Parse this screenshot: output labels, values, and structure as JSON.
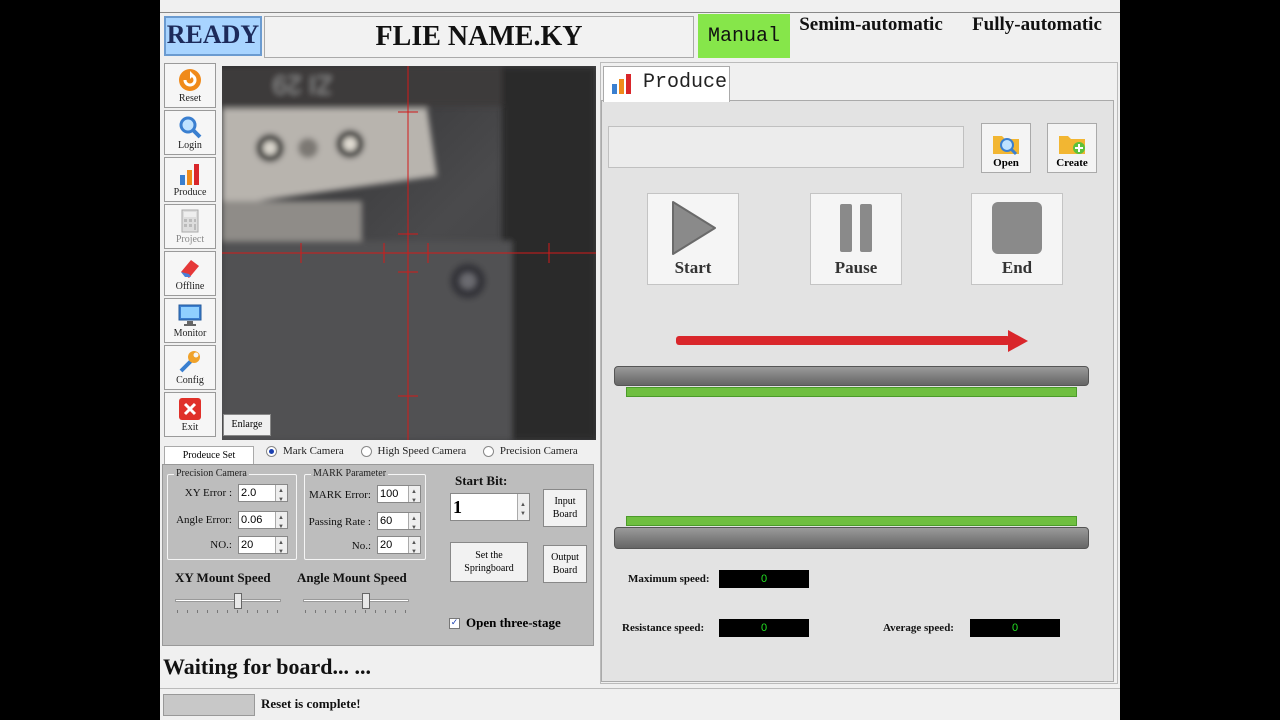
{
  "header": {
    "status": "READY",
    "filename": "FLIE NAME.KY",
    "modes": [
      "Manual",
      "Semim-automatic",
      "Fully-automatic"
    ],
    "active_mode": "Manual"
  },
  "toolbar": {
    "items": [
      {
        "label": "Reset",
        "icon": "reset-icon"
      },
      {
        "label": "Login",
        "icon": "magnifier-icon"
      },
      {
        "label": "Produce",
        "icon": "bar-chart-icon"
      },
      {
        "label": "Project",
        "icon": "calculator-icon"
      },
      {
        "label": "Offline",
        "icon": "eraser-icon"
      },
      {
        "label": "Monitor",
        "icon": "monitor-icon"
      },
      {
        "label": "Config",
        "icon": "wrench-icon"
      },
      {
        "label": "Exit",
        "icon": "close-icon"
      }
    ]
  },
  "camera": {
    "enlarge_label": "Enlarge",
    "options": [
      "Mark Camera",
      "High Speed Camera",
      "Precision Camera"
    ],
    "selected": "Mark Camera"
  },
  "produce_set": {
    "tab_label": "Prodeuce Set",
    "precision_camera": {
      "title": "Precision Camera",
      "xy_error_label": "XY Error :",
      "xy_error": "2.0",
      "angle_error_label": "Angle Error:",
      "angle_error": "0.06",
      "no_label": "NO.:",
      "no": "20"
    },
    "mark_parameter": {
      "title": "MARK Parameter",
      "mark_error_label": "MARK Error:",
      "mark_error": "100",
      "passing_rate_label": "Passing Rate :",
      "passing_rate": "60",
      "no_label": "No.:",
      "no": "20"
    },
    "start_bit_label": "Start Bit:",
    "start_bit": "1",
    "input_board_label": [
      "Input",
      "Board"
    ],
    "output_board_label": [
      "Output",
      "Board"
    ],
    "springboard_label": [
      "Set the",
      "Springboard"
    ],
    "xy_speed_label": "XY Mount Speed",
    "xy_speed": 0.6,
    "angle_speed_label": "Angle Mount Speed",
    "angle_speed": 0.6,
    "three_stage_label": "Open three-stage",
    "three_stage_checked": true
  },
  "status": {
    "waiting": "Waiting for board... ...",
    "reset_message": "Reset is complete!"
  },
  "produce": {
    "tab_label": "Produce",
    "open_label": "Open",
    "create_label": "Create",
    "start_label": "Start",
    "pause_label": "Pause",
    "end_label": "End",
    "max_speed_label": "Maximum speed:",
    "max_speed": "0",
    "resistance_speed_label": "Resistance speed:",
    "resistance_speed": "0",
    "average_speed_label": "Average speed:",
    "average_speed": "0"
  },
  "colors": {
    "ready_bg": "#a8d4ff",
    "manual_bg": "#86e64a",
    "arrow": "#d9262b",
    "conveyor_green": "#6fbf40",
    "speed_text": "#22e022"
  }
}
